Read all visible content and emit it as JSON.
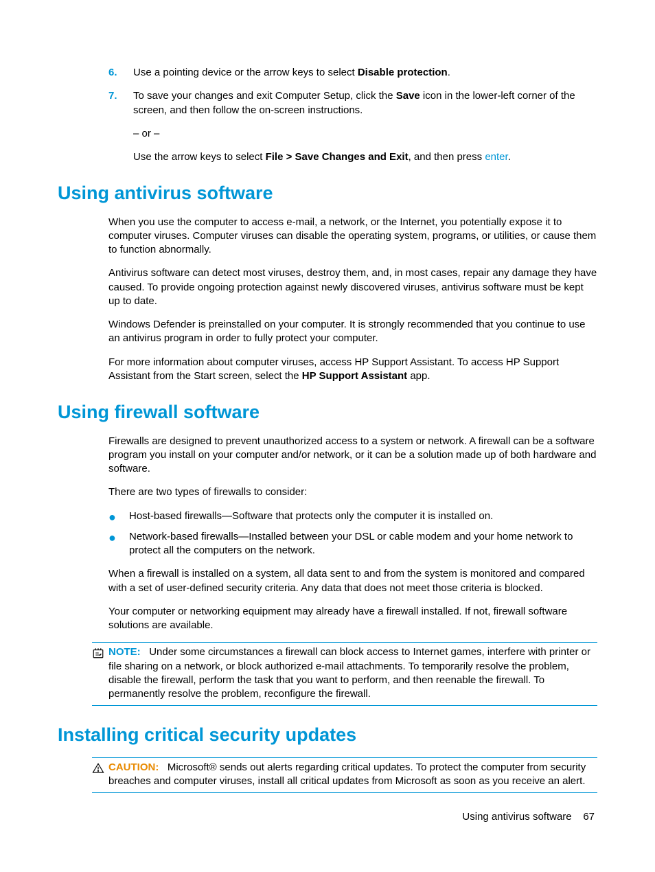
{
  "steps": {
    "six": {
      "num": "6.",
      "text_pre": "Use a pointing device or the arrow keys to select ",
      "bold": "Disable protection",
      "text_post": "."
    },
    "seven": {
      "num": "7.",
      "line1_pre": "To save your changes and exit Computer Setup, click the ",
      "line1_bold": "Save",
      "line1_post": " icon in the lower-left corner of the screen, and then follow the on-screen instructions.",
      "or": "– or –",
      "line2_pre": "Use the arrow keys to select ",
      "line2_bold": "File > Save Changes and Exit",
      "line2_mid": ", and then press ",
      "line2_key": "enter",
      "line2_post": "."
    }
  },
  "antivirus": {
    "heading": "Using antivirus software",
    "p1": "When you use the computer to access e-mail, a network, or the Internet, you potentially expose it to computer viruses. Computer viruses can disable the operating system, programs, or utilities, or cause them to function abnormally.",
    "p2": "Antivirus software can detect most viruses, destroy them, and, in most cases, repair any damage they have caused. To provide ongoing protection against newly discovered viruses, antivirus software must be kept up to date.",
    "p3": "Windows Defender is preinstalled on your computer. It is strongly recommended that you continue to use an antivirus program in order to fully protect your computer.",
    "p4_pre": "For more information about computer viruses, access HP Support Assistant. To access HP Support Assistant from the Start screen, select the ",
    "p4_bold": "HP Support Assistant",
    "p4_post": " app."
  },
  "firewall": {
    "heading": "Using firewall software",
    "p1": "Firewalls are designed to prevent unauthorized access to a system or network. A firewall can be a software program you install on your computer and/or network, or it can be a solution made up of both hardware and software.",
    "p2": "There are two types of firewalls to consider:",
    "bullets": [
      "Host-based firewalls—Software that protects only the computer it is installed on.",
      "Network-based firewalls—Installed between your DSL or cable modem and your home network to protect all the computers on the network."
    ],
    "p3": "When a firewall is installed on a system, all data sent to and from the system is monitored and compared with a set of user-defined security criteria. Any data that does not meet those criteria is blocked.",
    "p4": "Your computer or networking equipment may already have a firewall installed. If not, firewall software solutions are available.",
    "note_label": "NOTE:",
    "note_body": "Under some circumstances a firewall can block access to Internet games, interfere with printer or file sharing on a network, or block authorized e-mail attachments. To temporarily resolve the problem, disable the firewall, perform the task that you want to perform, and then reenable the firewall. To permanently resolve the problem, reconfigure the firewall."
  },
  "updates": {
    "heading": "Installing critical security updates",
    "caution_label": "CAUTION:",
    "caution_body": "Microsoft® sends out alerts regarding critical updates. To protect the computer from security breaches and computer viruses, install all critical updates from Microsoft as soon as you receive an alert."
  },
  "footer": {
    "text": "Using antivirus software",
    "page": "67"
  }
}
